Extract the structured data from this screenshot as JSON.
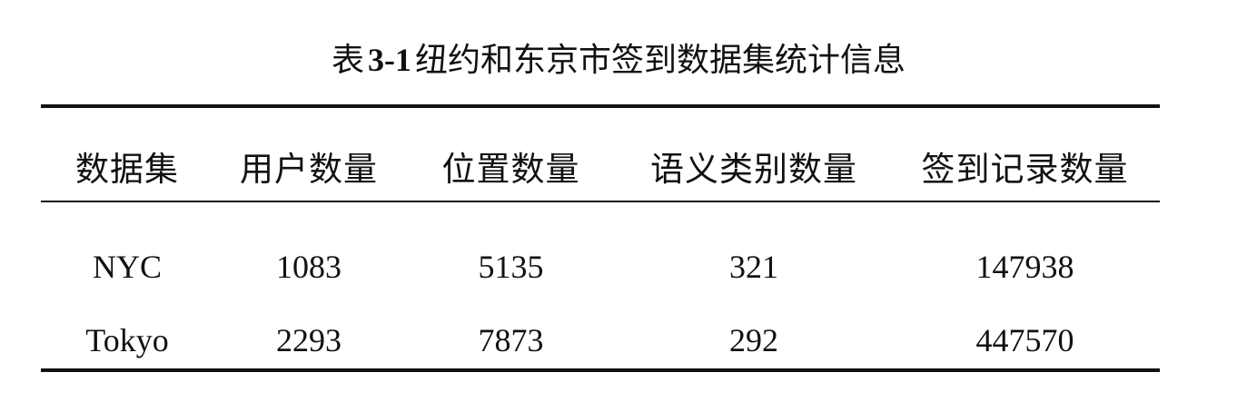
{
  "caption": {
    "prefix": "表",
    "number": "3-1",
    "text": "纽约和东京市签到数据集统计信息"
  },
  "table": {
    "headers": [
      "数据集",
      "用户数量",
      "位置数量",
      "语义类别数量",
      "签到记录数量"
    ],
    "rows": [
      [
        "NYC",
        "1083",
        "5135",
        "321",
        "147938"
      ],
      [
        "Tokyo",
        "2293",
        "7873",
        "292",
        "447570"
      ]
    ]
  }
}
